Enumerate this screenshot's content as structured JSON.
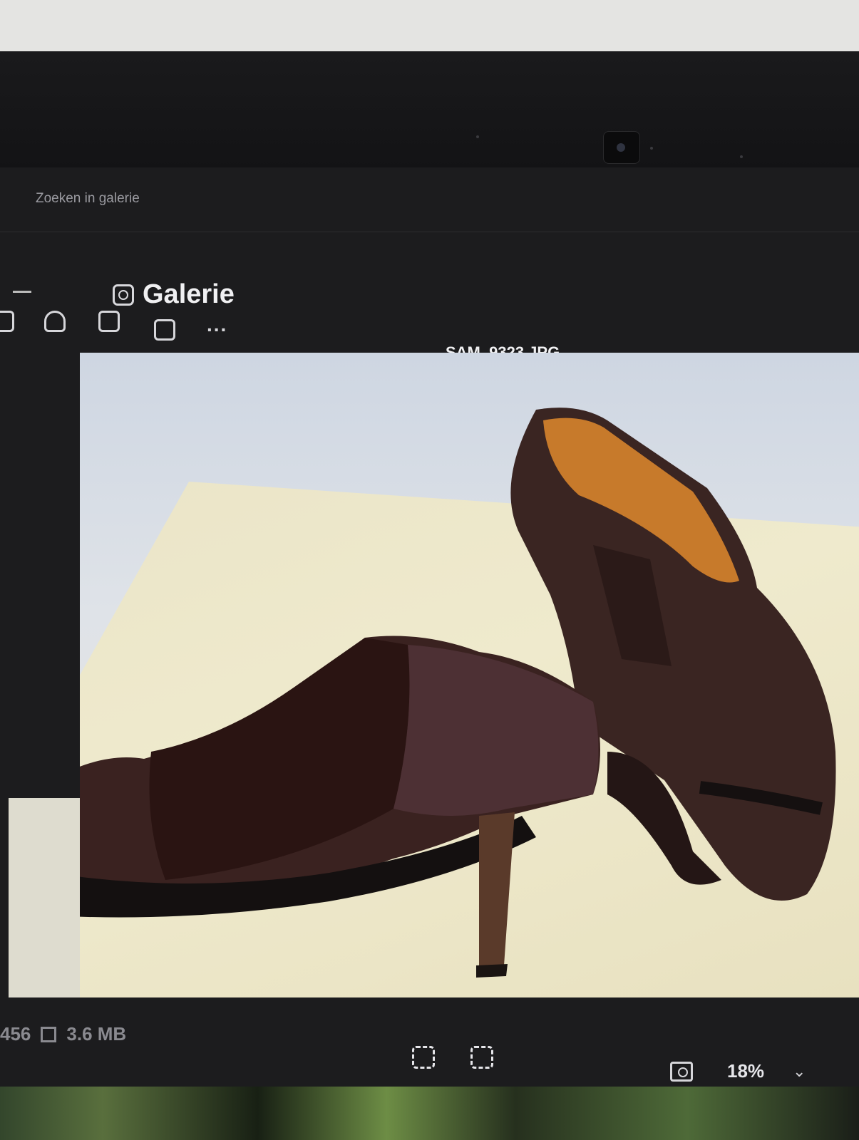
{
  "window": {
    "search_placeholder": "Zoeken in galerie",
    "title": "Galerie"
  },
  "viewer": {
    "filename": "SAM_9323.JPG"
  },
  "toolbar": {
    "items": [
      "rotate-icon",
      "print-icon",
      "share-icon",
      "slideshow-icon",
      "more-icon"
    ],
    "more_label": "..."
  },
  "status": {
    "dimensions_partial": "456",
    "file_size": "3.6 MB",
    "zoom": "18%"
  },
  "colors": {
    "screen_bg": "#1c1c1e",
    "accent": "#2b7de0"
  }
}
